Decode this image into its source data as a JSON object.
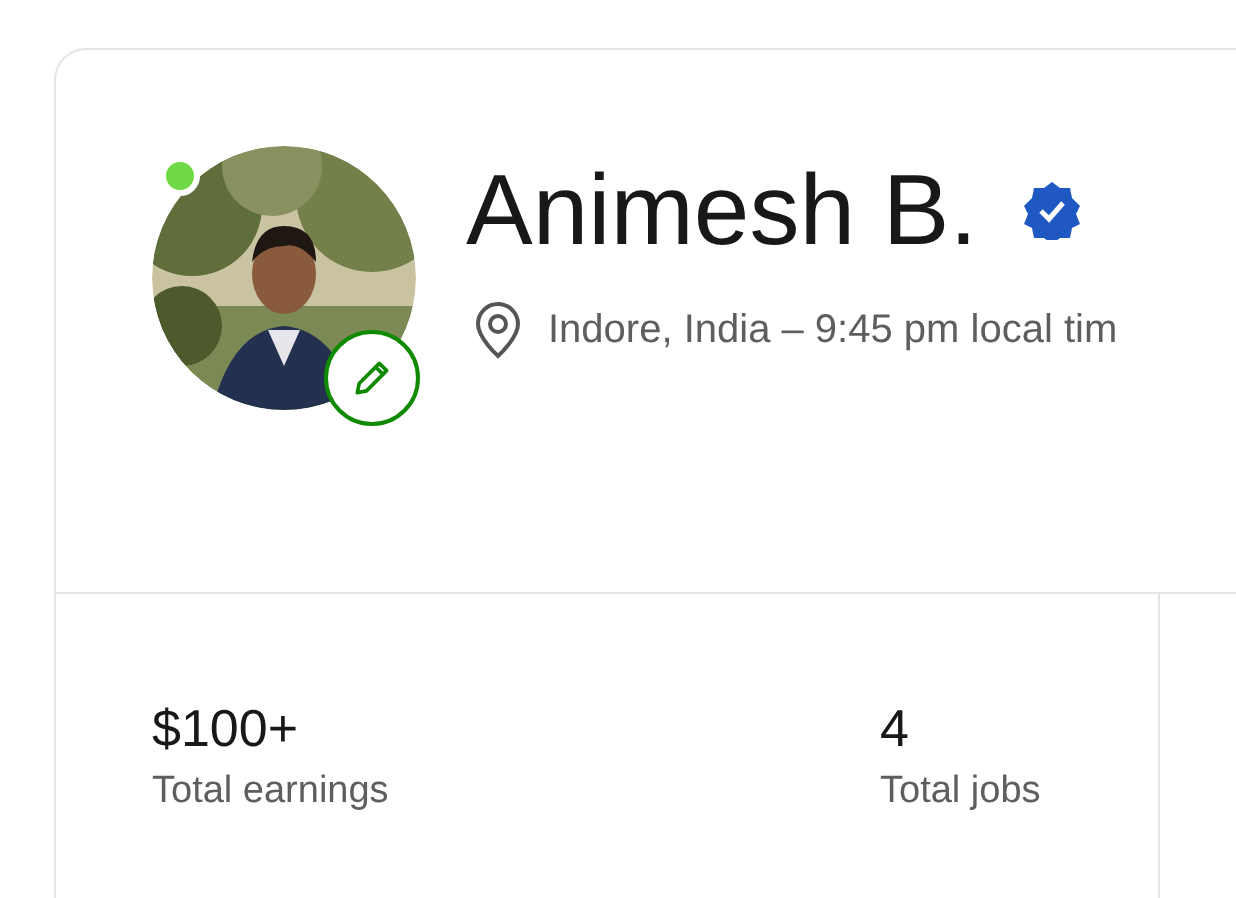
{
  "profile": {
    "name": "Animesh B.",
    "verified": true,
    "online": true,
    "location": "Indore, India – 9:45 pm local tim"
  },
  "stats": [
    {
      "value": "$100+",
      "label": "Total earnings"
    },
    {
      "value": "4",
      "label": "Total jobs"
    }
  ]
}
